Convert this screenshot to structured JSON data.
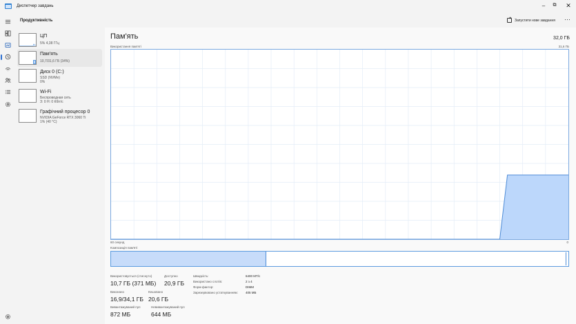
{
  "window": {
    "title": "Диспетчер завдань"
  },
  "header": {
    "section": "Продуктивність",
    "run_task": "Запустити нове завдання",
    "more": "···"
  },
  "perf_items": [
    {
      "name": "ЦП",
      "sub1": "5% 4,38 ГГц",
      "sub2": "",
      "sub3": ""
    },
    {
      "name": "Пам'ять",
      "sub1": "10,7/31,6 ГБ (34%)",
      "sub2": "",
      "sub3": ""
    },
    {
      "name": "Диск 0 (C:)",
      "sub1": "SSD (NVMe)",
      "sub2": "0%",
      "sub3": ""
    },
    {
      "name": "Wi-Fi",
      "sub1": "Беспроводная сеть",
      "sub2": "З: 0 Н: 0 Кбіт/с",
      "sub3": ""
    },
    {
      "name": "Графічний процесор 0",
      "sub1": "NVIDIA GeForce RTX 3060 Ti",
      "sub2": "1% (40 °C)",
      "sub3": ""
    }
  ],
  "main": {
    "title": "Пам'ять",
    "total": "32,0 ГБ",
    "usage_label": "Використання пам'яті",
    "usage_max": "31,6 ГБ",
    "axis_left": "60 секунд",
    "axis_right": "0",
    "composition_label": "Композиція пам'яті"
  },
  "chart_data": {
    "type": "area",
    "title": "",
    "xlabel": "",
    "ylabel": "",
    "x": [
      60,
      9,
      8,
      0
    ],
    "values": [
      0,
      0,
      10.7,
      10.7
    ],
    "xlim": [
      60,
      0
    ],
    "ylim": [
      0,
      31.6
    ],
    "grid": true,
    "color": "#bcd7fb",
    "line_color": "#4d8bd6"
  },
  "composition": {
    "in_use_fraction": 0.34
  },
  "stats": {
    "in_use_label": "Використовується (стиснуто)",
    "in_use_value": "10,7 ГБ (371 МБ)",
    "available_label": "Доступно",
    "available_value": "20,9 ГБ",
    "committed_label": "Виконано",
    "committed_value": "16,9/34,1 ГБ",
    "cached_label": "Кешовано",
    "cached_value": "20,6 ГБ",
    "paged_label": "Вивантажуваний пул",
    "paged_value": "872 МБ",
    "nonpaged_label": "Невивантажуваний пул",
    "nonpaged_value": "644 МБ"
  },
  "specs": [
    {
      "key": "Швидкість:",
      "value": "6400 МТ/с"
    },
    {
      "key": "Використано слотів:",
      "value": "2 з 4"
    },
    {
      "key": "Форм-фактор:",
      "value": "DIMM"
    },
    {
      "key": "Зарезервовано устаткуванням:",
      "value": "405 МБ"
    }
  ],
  "nav_icons": [
    "menu-icon",
    "processes-icon",
    "performance-icon",
    "app-history-icon",
    "startup-icon",
    "users-icon",
    "details-icon",
    "services-icon",
    "settings-icon"
  ]
}
